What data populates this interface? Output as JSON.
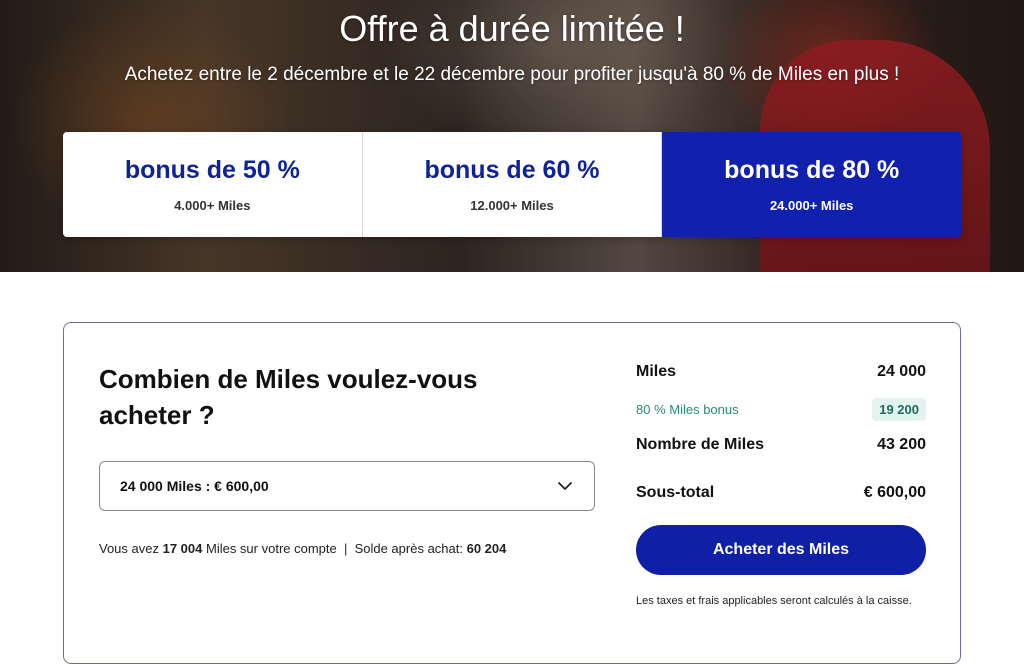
{
  "hero": {
    "title": "Offre à durée limitée !",
    "subtitle": "Achetez entre le 2 décembre et le 22 décembre pour profiter jusqu'à 80 % de Miles en plus !"
  },
  "tiers": [
    {
      "label": "bonus de 50 %",
      "miles": "4.000+ Miles",
      "active": false
    },
    {
      "label": "bonus de 60 %",
      "miles": "12.000+ Miles",
      "active": false
    },
    {
      "label": "bonus de 80 %",
      "miles": "24.000+ Miles",
      "active": true
    }
  ],
  "purchase": {
    "question": "Combien de Miles voulez-vous acheter ?",
    "selected_option": "24 000 Miles : € 600,00",
    "balance_prefix": "Vous avez ",
    "current_balance": "17 004",
    "balance_middle": " Miles sur votre compte  |  Solde après achat: ",
    "after_balance": "60 204"
  },
  "summary": {
    "miles_label": "Miles",
    "miles_value": "24 000",
    "bonus_label": "80 % Miles bonus",
    "bonus_value": "19 200",
    "total_label": "Nombre de Miles",
    "total_value": "43 200",
    "subtotal_label": "Sous-total",
    "subtotal_value": "€ 600,00",
    "buy_button": "Acheter des Miles",
    "tax_note": "Les taxes et frais applicables seront calculés à la caisse."
  },
  "colors": {
    "brand_blue": "#1121ad",
    "bonus_green": "#2a8a7a"
  },
  "icons": {
    "select_chevron": "chevron-down-icon"
  }
}
